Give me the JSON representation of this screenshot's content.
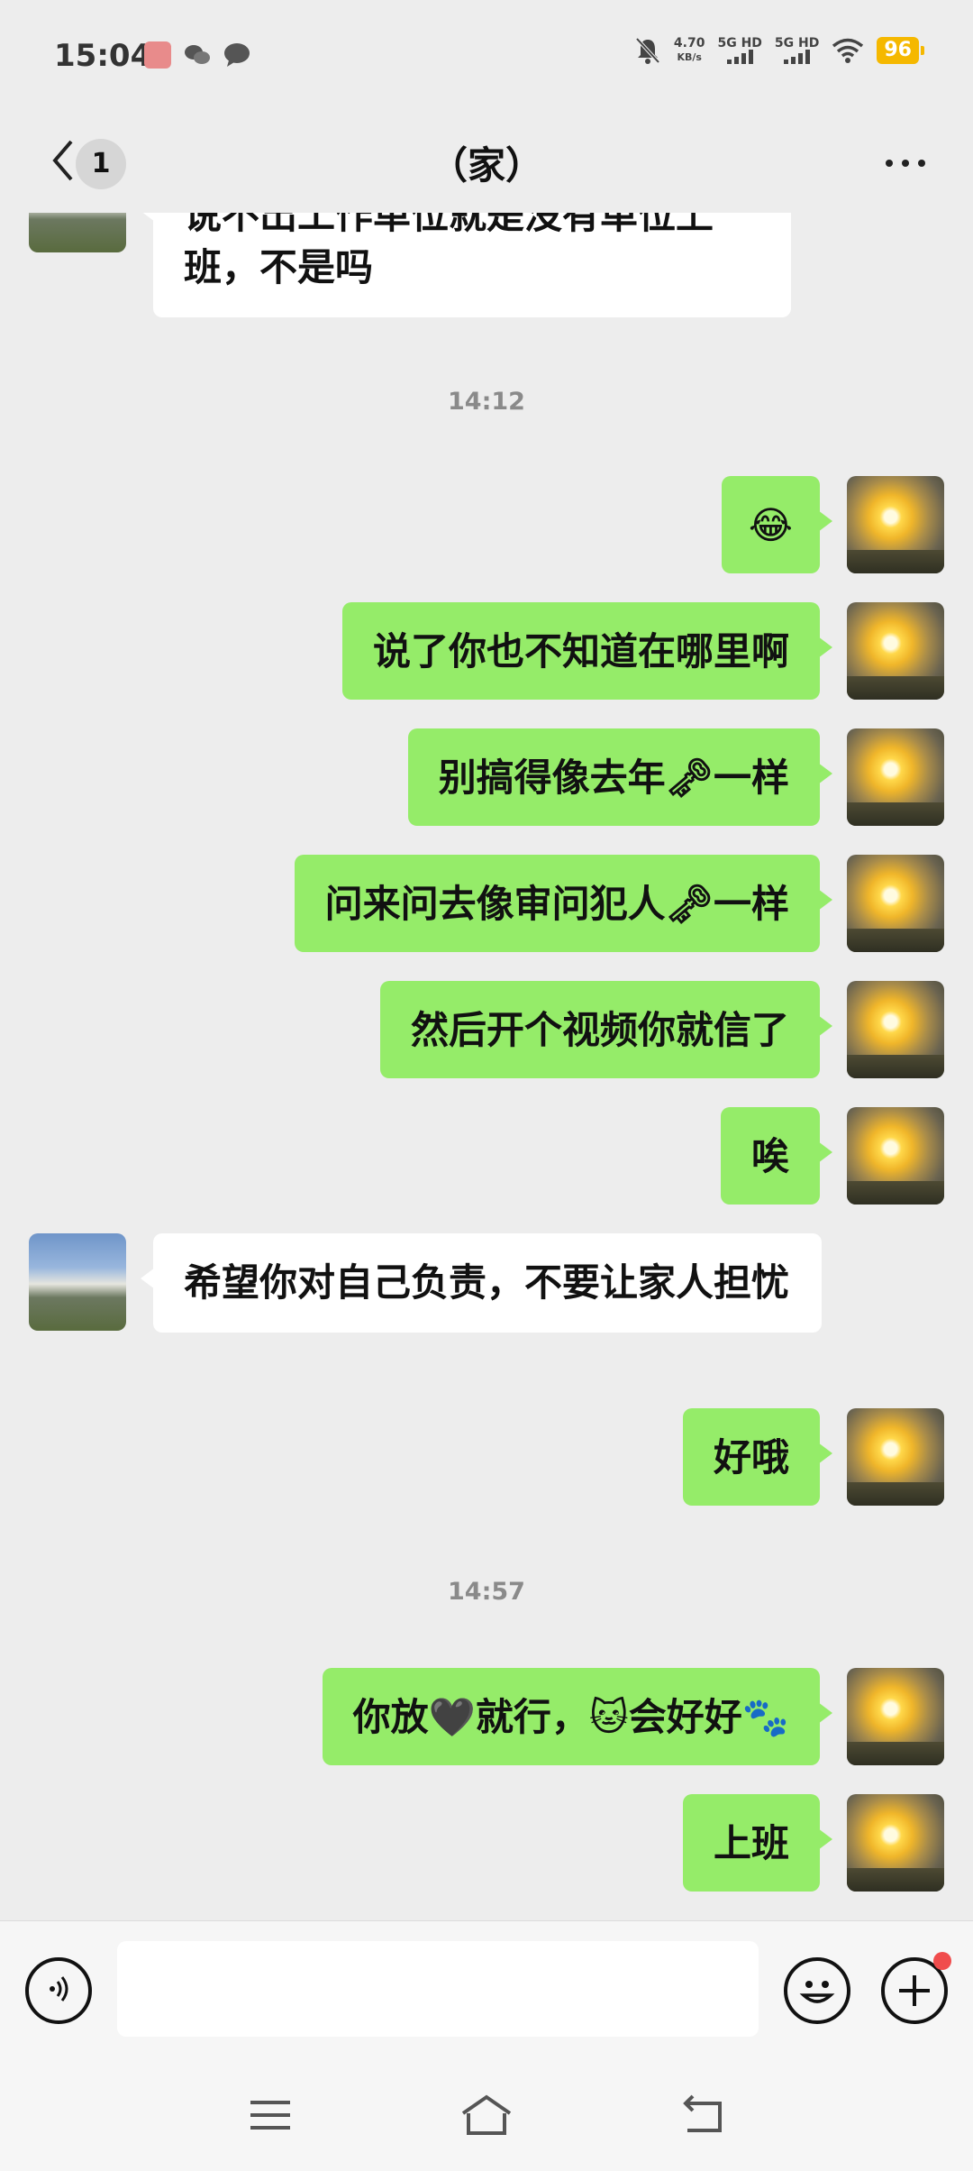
{
  "status_bar": {
    "time": "15:04",
    "net_speed_value": "4.70",
    "net_speed_unit": "KB/s",
    "sim1": "5G HD",
    "sim2": "5G HD",
    "battery": "96"
  },
  "nav": {
    "unread_count": "1",
    "title": "（家）"
  },
  "messages": [
    {
      "side": "other",
      "text": "说不出工作单位就是没有单位上班，不是吗"
    },
    {
      "side": "timestamp",
      "text": "14:12"
    },
    {
      "side": "me",
      "text": "😂"
    },
    {
      "side": "me",
      "text": "说了你也不知道在哪里啊"
    },
    {
      "side": "me",
      "text": "别搞得像去年🗝一样"
    },
    {
      "side": "me",
      "text": "问来问去像审问犯人🗝一样"
    },
    {
      "side": "me",
      "text": "然后开个视频你就信了"
    },
    {
      "side": "me",
      "text": "唉"
    },
    {
      "side": "other",
      "text": "希望你对自己负责，不要让家人担忧"
    },
    {
      "side": "me",
      "text": "好哦"
    },
    {
      "side": "timestamp",
      "text": "14:57"
    },
    {
      "side": "me",
      "text": "你放🖤就行，🐱会好好🐾"
    },
    {
      "side": "me",
      "text": "上班"
    }
  ],
  "input": {
    "placeholder": ""
  },
  "icons": {
    "back": "chevron-left-icon",
    "more": "more-dots-icon",
    "voice": "voice-icon",
    "emoji": "smiley-icon",
    "plus": "plus-icon",
    "menu": "menu-icon",
    "home": "home-icon",
    "return": "return-icon"
  },
  "colors": {
    "my_bubble": "#95ec69",
    "other_bubble": "#ffffff",
    "background": "#ededed",
    "battery": "#f5b800",
    "notification_dot": "#f04c4c"
  }
}
